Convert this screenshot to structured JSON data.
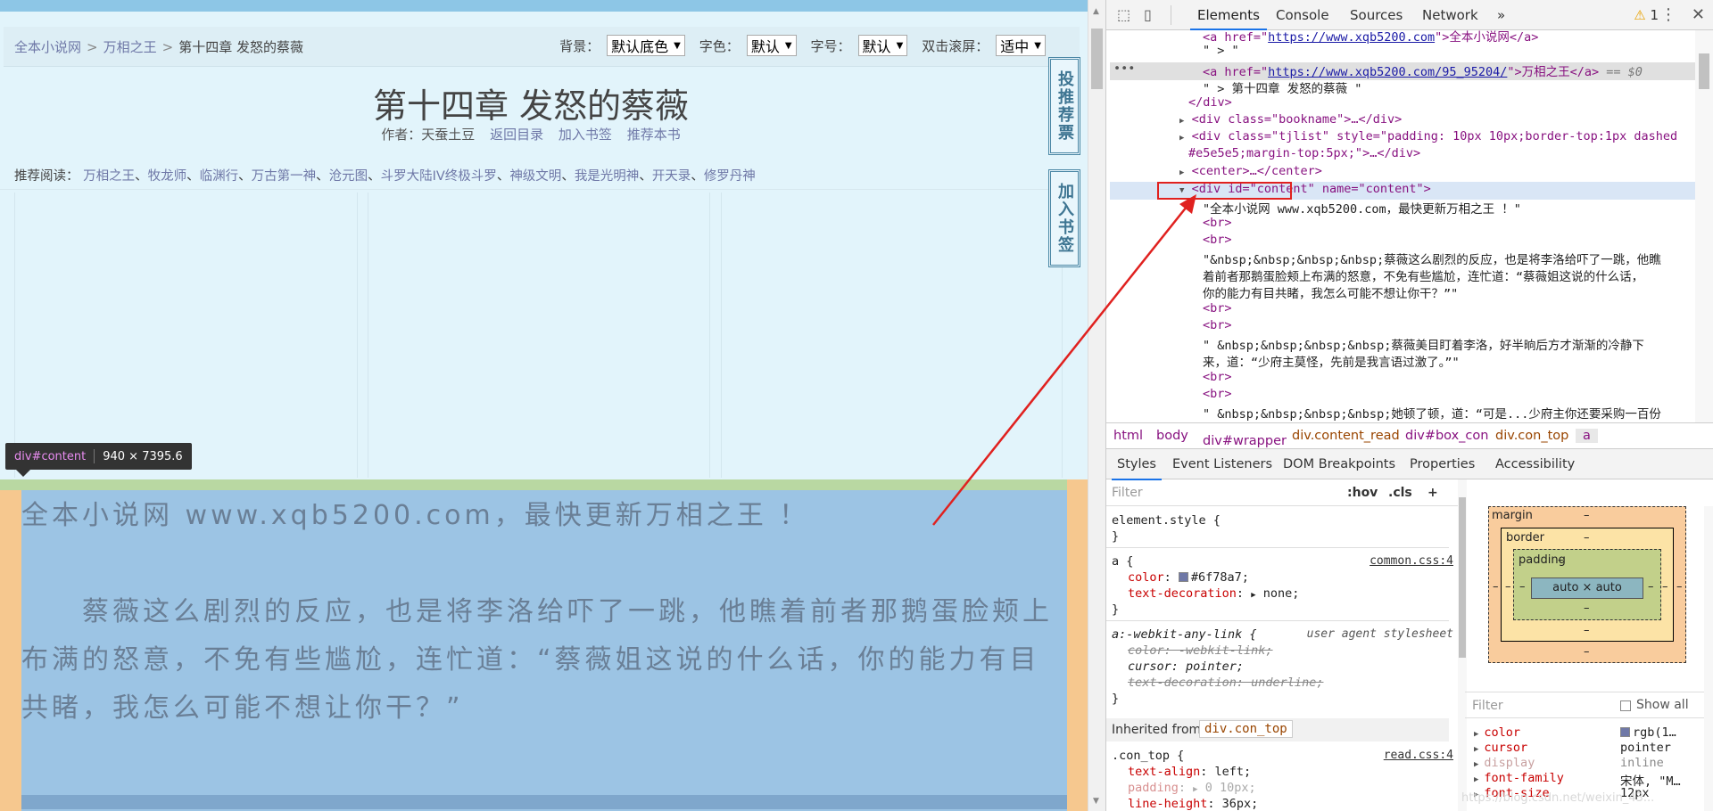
{
  "web": {
    "breadcrumb": {
      "site": "全本小说网",
      "book": "万相之王",
      "current": "第十四章 发怒的蔡薇",
      "sep": ">"
    },
    "options": {
      "bg_label": "背景：",
      "bg_value": "默认底色",
      "color_label": "字色：",
      "color_value": "默认",
      "size_label": "字号：",
      "size_value": "默认",
      "scroll_label": "双击滚屏：",
      "scroll_value": "适中"
    },
    "chapter_title": "第十四章  发怒的蔡薇",
    "author_text": "作者：天蚕土豆",
    "links": {
      "back": "返回目录",
      "bookmark": "加入书签",
      "recommend": "推荐本书"
    },
    "tjlist": {
      "label": "推荐阅读：",
      "items": [
        "万相之王",
        "牧龙师",
        "临渊行",
        "万古第一神",
        "沧元图",
        "斗罗大陆IV终极斗罗",
        "神级文明",
        "我是光明神",
        "开天录",
        "修罗丹神"
      ],
      "sep": "、"
    },
    "side": {
      "vote": "投推荐票",
      "bookmark": "加入书签"
    },
    "tooltip": {
      "id": "div#content",
      "size": "940 × 7395.6"
    },
    "content": {
      "line1": "全本小说网 www.xqb5200.com，最快更新万相之王 ！",
      "para1": "　　蔡薇这么剧烈的反应，也是将李洛给吓了一跳，他瞧着前者那鹅蛋脸颊上布满的怒意，不免有些尴尬，连忙道：“蔡薇姐这说的什么话，你的能力有目共睹，我怎么可能不想让你干？”"
    }
  },
  "devtools": {
    "tabs": [
      "Elements",
      "Console",
      "Sources",
      "Network"
    ],
    "more": "»",
    "warn_count": "1",
    "dom": {
      "line0": {
        "pre": "<a href=\"",
        "url": "https://www.xqb5200.com",
        "post": "\">全本小说网</a>"
      },
      "line1": "\" > \"",
      "line2": {
        "pre": "<a href=\"",
        "url": "https://www.xqb5200.com/95_95204/",
        "post": "\">万相之王</a>",
        "eq": "== $0"
      },
      "line3": "\" > 第十四章 发怒的蔡薇 \"",
      "line4": "</div>",
      "line5": "<div class=\"bookname\">…</div>",
      "line6": "<div class=\"tjlist\" style=\"padding: 10px 10px;border-top:1px dashed",
      "line6b": "#e5e5e5;margin-top:5px;\">…</div>",
      "line7": "<center>…</center>",
      "line8a": "<div id=\"content\"",
      "line8b": " name=\"content\">",
      "line9": "\"全本小说网 www.xqb5200.com，最快更新万相之王 ！\"",
      "br": "<br>",
      "p1a": "\"&nbsp;&nbsp;&nbsp;&nbsp;蔡薇这么剧烈的反应，也是将李洛给吓了一跳，他瞧",
      "p1b": "着前者那鹅蛋脸颊上布满的怒意，不免有些尴尬，连忙道：“蔡薇姐这说的什么话，",
      "p1c": "你的能力有目共睹，我怎么可能不想让你干？”\"",
      "p2a": "\" &nbsp;&nbsp;&nbsp;&nbsp;蔡薇美目盯着李洛，好半晌后方才渐渐的冷静下",
      "p2b": "来，道：“少府主莫怪，先前是我言语过激了。”\"",
      "p3a": "\" &nbsp;&nbsp;&nbsp;&nbsp;她顿了顿，道：“可是...少府主你还要采购一百份"
    },
    "crumbs": [
      "html",
      "body",
      "div#wrapper",
      "div.content_read",
      "div#box_con",
      "div.con_top",
      "a"
    ],
    "subtabs": [
      "Styles",
      "Event Listeners",
      "DOM Breakpoints",
      "Properties",
      "Accessibility"
    ],
    "styles": {
      "filter_placeholder": "Filter",
      "hov": ":hov",
      "cls": ".cls",
      "plus": "+",
      "el_style": "element.style {",
      "close": "}",
      "a_sel": "a {",
      "a_color_p": "color",
      "a_color_v": "#6f78a7;",
      "a_td_p": "text-decoration",
      "a_td_v": "none;",
      "a_src": "common.css:4",
      "a_color_hex": "#6f78a7",
      "ua_sel": "a:-webkit-any-link {",
      "ua_label": "user agent stylesheet",
      "ua_color": "color: -webkit-link;",
      "ua_cursor": "cursor: pointer;",
      "ua_td": "text-decoration: underline;",
      "inh_label": "Inherited from",
      "inh_val": "div.con_top",
      "ct_sel": ".con_top {",
      "ct_src": "read.css:4",
      "ct_ta_p": "text-align",
      "ct_ta_v": "left;",
      "ct_pad_p": "padding",
      "ct_pad_v": "0 10px;",
      "ct_lh_p": "line-height",
      "ct_lh_v": "36px;"
    },
    "boxmodel": {
      "margin": "margin",
      "border": "border",
      "padding": "padding",
      "content": "auto × auto",
      "dash": "–"
    },
    "computed": {
      "filter_placeholder": "Filter",
      "show_all": "Show all",
      "rows": [
        {
          "name": "color",
          "value": "rgb(1…",
          "swatch": "#6f78a7"
        },
        {
          "name": "cursor",
          "value": "pointer"
        },
        {
          "name": "display",
          "value": "inline"
        },
        {
          "name": "font-family",
          "value": "宋体, \"M…"
        },
        {
          "name": "font-size",
          "value": "12px"
        }
      ]
    }
  },
  "watermark": "https://blog.csdn.net/weixin_43..."
}
